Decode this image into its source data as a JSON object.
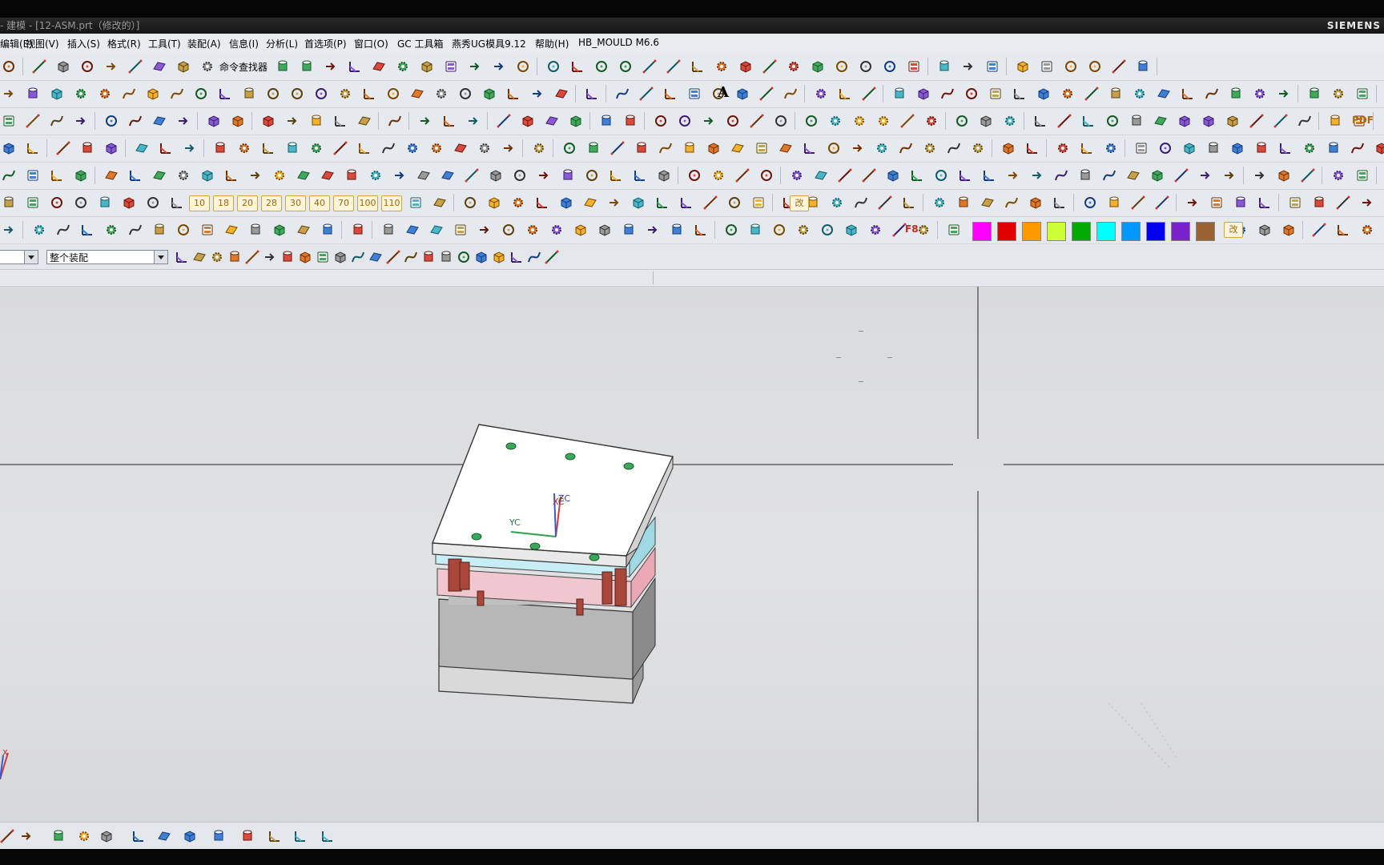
{
  "window": {
    "title": "- 建模 - [12-ASM.prt（修改的）]",
    "brand": "SIEMENS"
  },
  "menu": {
    "items": [
      "编辑(E)",
      "视图(V)",
      "插入(S)",
      "格式(R)",
      "工具(T)",
      "装配(A)",
      "信息(I)",
      "分析(L)",
      "首选项(P)",
      "窗口(O)",
      "GC 工具箱",
      "燕秀UG模具9.12",
      "帮助(H)",
      "HB_MOULD M6.6"
    ]
  },
  "toolbar": {
    "command_finder_label": "命令查找器",
    "pdf_label": "PDF",
    "number_buttons": [
      "10",
      "18",
      "20",
      "28",
      "30",
      "40",
      "70",
      "100",
      "110"
    ],
    "modify_label": "改",
    "text_tool_label": "A",
    "f8_label": "F8",
    "colors": [
      "#ff00ff",
      "#e00000",
      "#ff9900",
      "#ccff33",
      "#00aa00",
      "#00ffff",
      "#0099ff",
      "#0000ee",
      "#7722cc",
      "#9a6233"
    ]
  },
  "filter": {
    "type_filter_value": "",
    "scope_value": "整个装配"
  },
  "viewport": {
    "wcs_x_label": "XC",
    "wcs_y_label": "YC",
    "wcs_z_label": "ZC",
    "triad_label": "X"
  }
}
